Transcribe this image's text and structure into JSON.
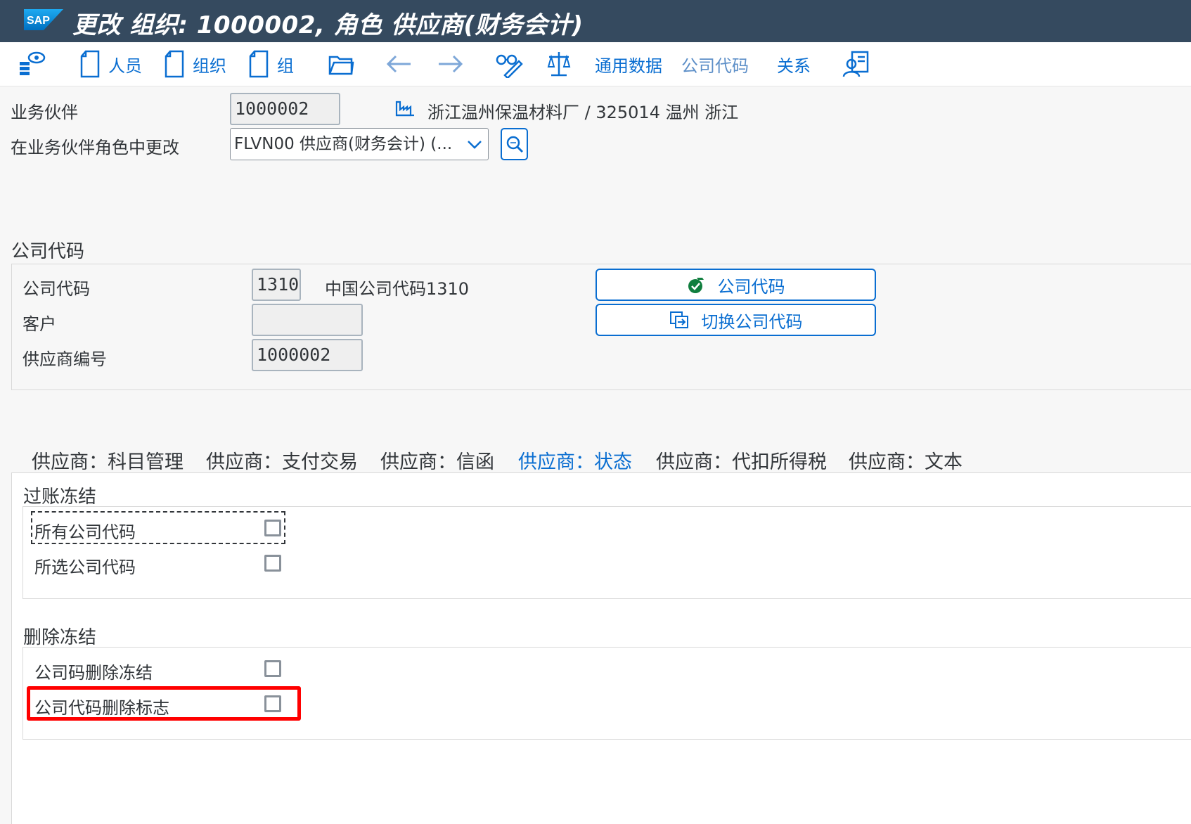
{
  "window": {
    "title": "更改 组织: 1000002, 角色 供应商(财务会计)",
    "logo_text": "SAP"
  },
  "toolbar": {
    "person_label": "人员",
    "org_label": "组织",
    "group_label": "组",
    "general_data_label": "通用数据",
    "company_code_label": "公司代码",
    "relationships_label": "关系"
  },
  "header": {
    "bp_label": "业务伙伴",
    "bp_value": "1000002",
    "bp_description": "浙江温州保温材料厂 / 325014 温州 浙江",
    "role_label": "在业务伙伴角色中更改",
    "role_value": "FLVN00  供应商(财务会计)  (..."
  },
  "company_code_section": {
    "title": "公司代码",
    "cc_label": "公司代码",
    "cc_value": "1310",
    "cc_description": "中国公司代码1310",
    "customer_label": "客户",
    "customer_value": "",
    "vendor_label": "供应商编号",
    "vendor_value": "1000002",
    "btn_company_code": "公司代码",
    "btn_switch": "切换公司代码"
  },
  "tabs": [
    {
      "label": "供应商：科目管理"
    },
    {
      "label": "供应商：支付交易"
    },
    {
      "label": "供应商：信函"
    },
    {
      "label": "供应商：状态"
    },
    {
      "label": "供应商：代扣所得税"
    },
    {
      "label": "供应商：文本"
    }
  ],
  "active_tab": "供应商：状态",
  "posting_block": {
    "title": "过账冻结",
    "all_cc_label": "所有公司代码",
    "all_cc_checked": false,
    "selected_cc_label": "所选公司代码",
    "selected_cc_checked": false
  },
  "deletion_block": {
    "title": "删除冻结",
    "cc_deletion_block_label": "公司码删除冻结",
    "cc_deletion_block_checked": false,
    "cc_deletion_flag_label": "公司代码删除标志",
    "cc_deletion_flag_checked": false
  },
  "colors": {
    "shell": "#354a5f",
    "accent": "#0a6ed1",
    "highlight": "#ff0000"
  }
}
